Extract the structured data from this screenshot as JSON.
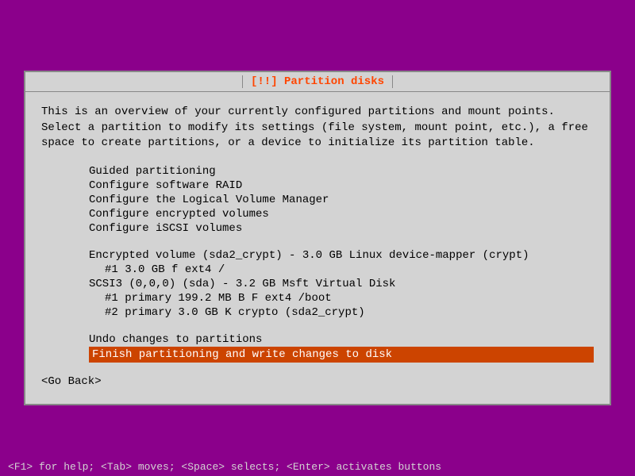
{
  "title": "[!!] Partition disks",
  "description": "This is an overview of your currently configured partitions and mount points. Select a partition to modify its settings (file system, mount point, etc.), a free space to create partitions, or a device to initialize its partition table.",
  "menu_items": [
    "Guided partitioning",
    "Configure software RAID",
    "Configure the Logical Volume Manager",
    "Configure encrypted volumes",
    "Configure iSCSI volumes"
  ],
  "partitions": {
    "encrypted_volume_label": "Encrypted volume (sda2_crypt) - 3.0 GB Linux device-mapper (crypt)",
    "encrypted_volume_part": "     #1         3.0 GB    f  ext4        /",
    "scsi_label": "SCSI3 (0,0,0) (sda) - 3.2 GB Msft Virtual Disk",
    "scsi_part1": "     #1  primary   199.2 MB  B  F  ext4      /boot",
    "scsi_part2": "     #2  primary     3.0 GB     K  crypto    (sda2_crypt)"
  },
  "undo_label": "Undo changes to partitions",
  "finish_label": "Finish partitioning and write changes to disk",
  "go_back_label": "<Go Back>",
  "status_bar": "<F1> for help; <Tab> moves; <Space> selects; <Enter> activates buttons"
}
